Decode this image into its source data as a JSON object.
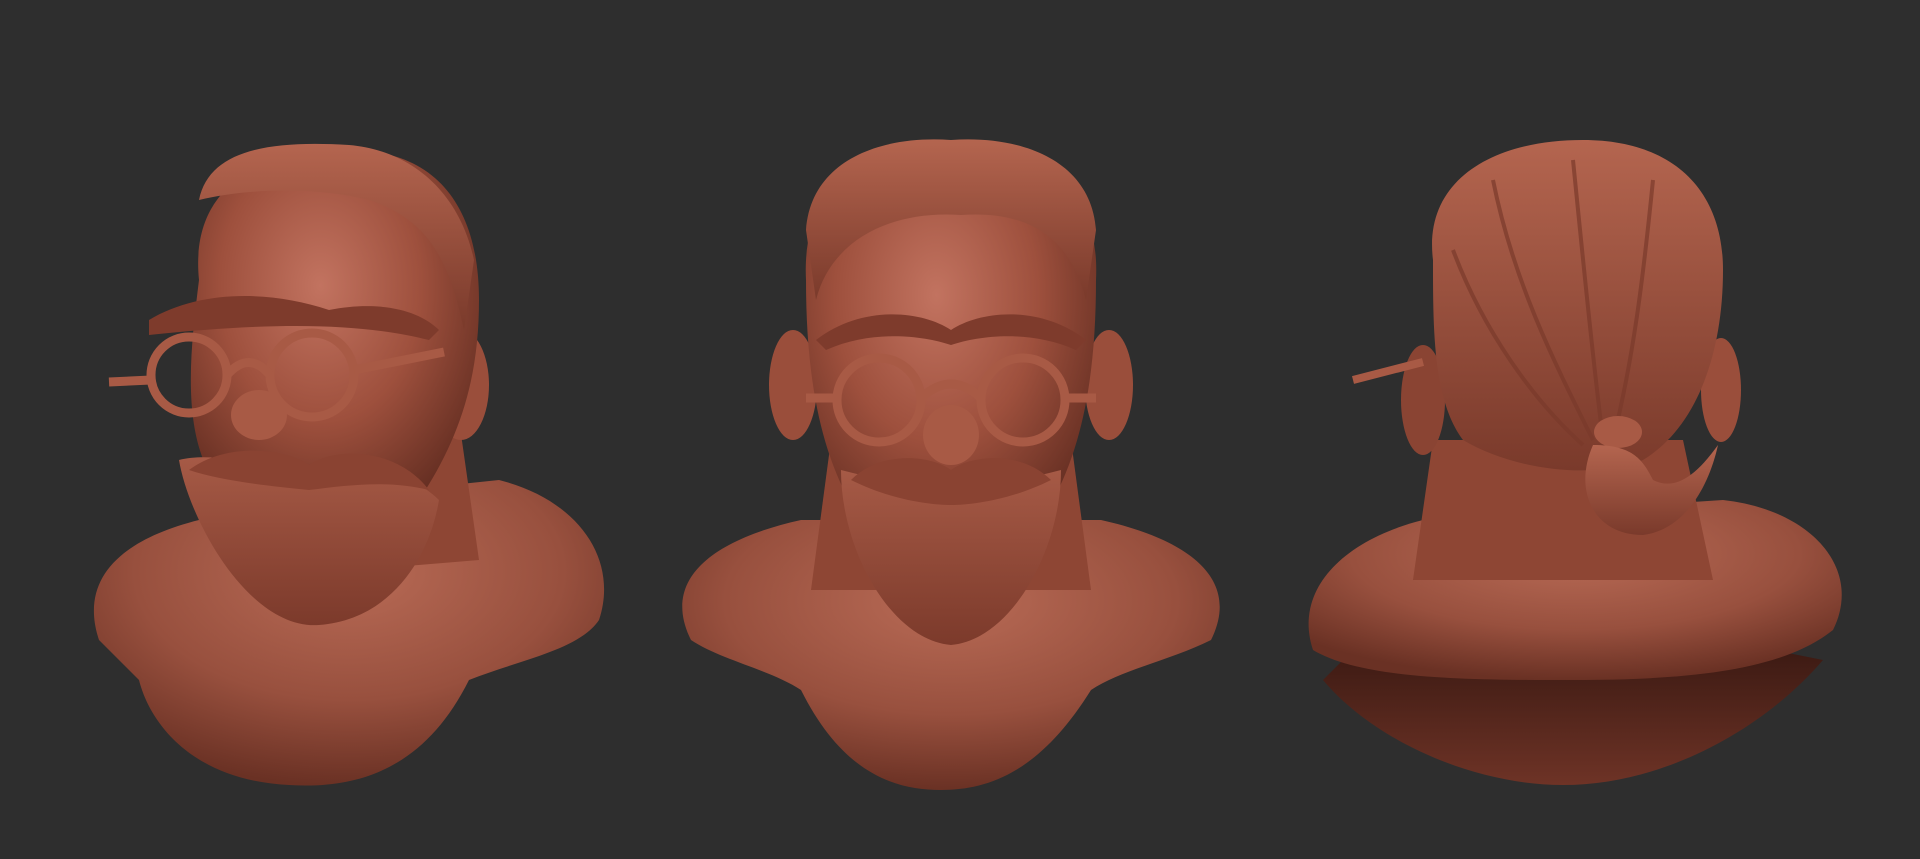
{
  "colors": {
    "background": "#2e2e2e",
    "clay_light": "#b86a54",
    "clay_mid": "#9a4e3b",
    "clay_dark": "#5e2a1f"
  },
  "views": [
    {
      "id": "three-quarter"
    },
    {
      "id": "front"
    },
    {
      "id": "back"
    }
  ]
}
